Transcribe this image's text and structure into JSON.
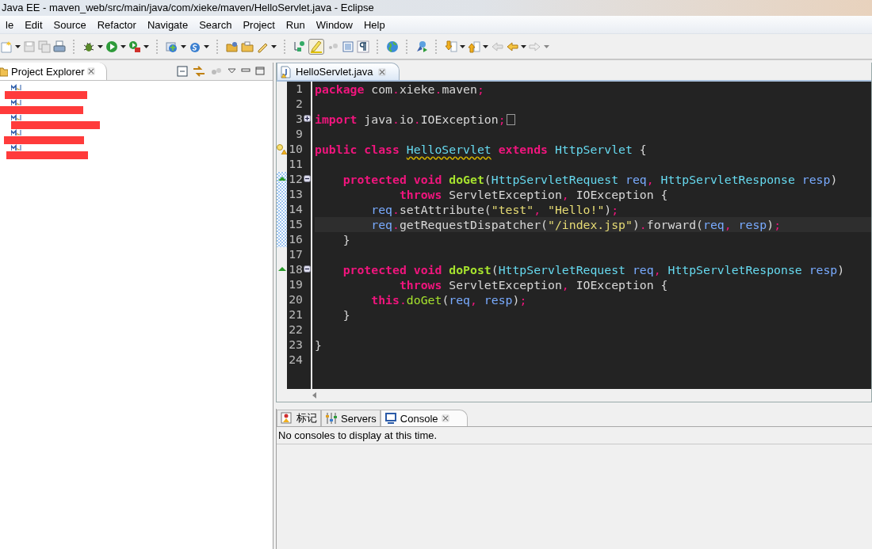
{
  "window": {
    "title": "Java EE - maven_web/src/main/java/com/xieke/maven/HelloServlet.java - Eclipse"
  },
  "menu": [
    "le",
    "Edit",
    "Source",
    "Refactor",
    "Navigate",
    "Search",
    "Project",
    "Run",
    "Window",
    "Help"
  ],
  "toolbar": {
    "highlight_toggle": {
      "pressed": true
    }
  },
  "project_explorer": {
    "title": "Project Explorer",
    "items": [
      {
        "kind": "redacted"
      },
      {
        "kind": "redacted"
      },
      {
        "kind": "redacted"
      },
      {
        "kind": "redacted"
      },
      {
        "kind": "redacted"
      }
    ]
  },
  "editor": {
    "tab": {
      "label": "HelloServlet.java",
      "selected": true
    },
    "lines": [
      {
        "number": "1",
        "current": false,
        "warning": false,
        "override": false,
        "in_range": false,
        "tokens": [
          {
            "text": "package",
            "kind": "kw"
          },
          {
            "text": " com",
            "kind": "pl"
          },
          {
            "text": ".",
            "kind": "op"
          },
          {
            "text": "xieke",
            "kind": "pl"
          },
          {
            "text": ".",
            "kind": "op"
          },
          {
            "text": "maven",
            "kind": "pl"
          },
          {
            "text": ";",
            "kind": "op"
          }
        ]
      },
      {
        "number": "2",
        "current": false,
        "warning": false,
        "override": false,
        "in_range": false
      },
      {
        "number": "3",
        "current": false,
        "warning": false,
        "override": false,
        "in_range": false,
        "fold_expanded": false,
        "tokens": [
          {
            "text": "import",
            "kind": "kw"
          },
          {
            "text": " java",
            "kind": "pl"
          },
          {
            "text": ".",
            "kind": "op"
          },
          {
            "text": "io",
            "kind": "pl"
          },
          {
            "text": ".",
            "kind": "op"
          },
          {
            "text": "IOException",
            "kind": "pl"
          },
          {
            "text": ";",
            "kind": "op"
          }
        ]
      },
      {
        "number": "9",
        "current": false,
        "warning": false,
        "override": false,
        "in_range": false
      },
      {
        "number": "10",
        "current": false,
        "warning": true,
        "override": false,
        "in_range": false,
        "tokens": [
          {
            "text": "public class ",
            "kind": "kw"
          },
          {
            "text": "HelloServlet",
            "kind": "warn"
          },
          {
            "text": " extends",
            "kind": "kw"
          },
          {
            "text": " HttpServlet",
            "kind": "type"
          },
          {
            "text": " {",
            "kind": "pl"
          }
        ]
      },
      {
        "number": "11",
        "current": false,
        "warning": false,
        "override": false,
        "in_range": false
      },
      {
        "number": "12",
        "current": false,
        "warning": false,
        "override": true,
        "in_range": true,
        "fold_expanded": true,
        "tokens": [
          {
            "text": "    protected void ",
            "kind": "kw"
          },
          {
            "text": "doGet",
            "kind": "method"
          },
          {
            "text": "(",
            "kind": "pl"
          },
          {
            "text": "HttpServletRequest",
            "kind": "type"
          },
          {
            "text": " req",
            "kind": "param"
          },
          {
            "text": ",",
            "kind": "op"
          },
          {
            "text": " HttpServletResponse",
            "kind": "type"
          },
          {
            "text": " resp",
            "kind": "param"
          },
          {
            "text": ")",
            "kind": "pl"
          }
        ]
      },
      {
        "number": "13",
        "current": false,
        "warning": false,
        "override": false,
        "in_range": true,
        "tokens": [
          {
            "text": "            throws",
            "kind": "kw"
          },
          {
            "text": " ServletException",
            "kind": "pl"
          },
          {
            "text": ",",
            "kind": "op"
          },
          {
            "text": " IOException {",
            "kind": "pl"
          }
        ]
      },
      {
        "number": "14",
        "current": false,
        "warning": false,
        "override": false,
        "in_range": true,
        "tokens": [
          {
            "text": "        req",
            "kind": "param"
          },
          {
            "text": ".",
            "kind": "op"
          },
          {
            "text": "setAttribute(",
            "kind": "pl"
          },
          {
            "text": "\"test\"",
            "kind": "str"
          },
          {
            "text": ",",
            "kind": "op"
          },
          {
            "text": " \"Hello!\"",
            "kind": "str"
          },
          {
            "text": ")",
            "kind": "pl"
          },
          {
            "text": ";",
            "kind": "op"
          }
        ]
      },
      {
        "number": "15",
        "current": true,
        "warning": false,
        "override": false,
        "in_range": true,
        "tokens": [
          {
            "text": "        req",
            "kind": "param"
          },
          {
            "text": ".",
            "kind": "op"
          },
          {
            "text": "getRequestDispatcher(",
            "kind": "pl"
          },
          {
            "text": "\"/index.jsp\"",
            "kind": "str"
          },
          {
            "text": ")",
            "kind": "pl"
          },
          {
            "text": ".",
            "kind": "op"
          },
          {
            "text": "forward(",
            "kind": "pl"
          },
          {
            "text": "req",
            "kind": "param"
          },
          {
            "text": ",",
            "kind": "op"
          },
          {
            "text": " resp",
            "kind": "param"
          },
          {
            "text": ")",
            "kind": "pl"
          },
          {
            "text": ";",
            "kind": "op"
          }
        ]
      },
      {
        "number": "16",
        "current": false,
        "warning": false,
        "override": false,
        "in_range": true,
        "tokens": [
          {
            "text": "    }",
            "kind": "pl"
          }
        ]
      },
      {
        "number": "17",
        "current": false,
        "warning": false,
        "override": false,
        "in_range": false
      },
      {
        "number": "18",
        "current": false,
        "warning": false,
        "override": true,
        "in_range": false,
        "fold_expanded": true,
        "tokens": [
          {
            "text": "    protected void ",
            "kind": "kw"
          },
          {
            "text": "doPost",
            "kind": "method"
          },
          {
            "text": "(",
            "kind": "pl"
          },
          {
            "text": "HttpServletRequest",
            "kind": "type"
          },
          {
            "text": " req",
            "kind": "param"
          },
          {
            "text": ",",
            "kind": "op"
          },
          {
            "text": " HttpServletResponse",
            "kind": "type"
          },
          {
            "text": " resp",
            "kind": "param"
          },
          {
            "text": ")",
            "kind": "pl"
          }
        ]
      },
      {
        "number": "19",
        "current": false,
        "warning": false,
        "override": false,
        "in_range": false,
        "tokens": [
          {
            "text": "            throws",
            "kind": "kw"
          },
          {
            "text": " ServletException",
            "kind": "pl"
          },
          {
            "text": ",",
            "kind": "op"
          },
          {
            "text": " IOException {",
            "kind": "pl"
          }
        ]
      },
      {
        "number": "20",
        "current": false,
        "warning": false,
        "override": false,
        "in_range": false,
        "tokens": [
          {
            "text": "        this",
            "kind": "kw"
          },
          {
            "text": ".",
            "kind": "op"
          },
          {
            "text": "doGet",
            "kind": "call"
          },
          {
            "text": "(",
            "kind": "pl"
          },
          {
            "text": "req",
            "kind": "param"
          },
          {
            "text": ",",
            "kind": "op"
          },
          {
            "text": " resp",
            "kind": "param"
          },
          {
            "text": ")",
            "kind": "pl"
          },
          {
            "text": ";",
            "kind": "op"
          }
        ]
      },
      {
        "number": "21",
        "current": false,
        "warning": false,
        "override": false,
        "in_range": false,
        "tokens": [
          {
            "text": "    }",
            "kind": "pl"
          }
        ]
      },
      {
        "number": "22",
        "current": false,
        "warning": false,
        "override": false,
        "in_range": false
      },
      {
        "number": "23",
        "current": false,
        "warning": false,
        "override": false,
        "in_range": false,
        "tokens": [
          {
            "text": "}",
            "kind": "pl"
          }
        ]
      },
      {
        "number": "24",
        "current": false,
        "warning": false,
        "override": false,
        "in_range": false
      }
    ]
  },
  "bottom_panel": {
    "tabs": [
      {
        "label": "标记",
        "kind": "markers",
        "selected": false
      },
      {
        "label": "Servers",
        "kind": "servers",
        "selected": false
      },
      {
        "label": "Console",
        "kind": "console",
        "selected": true
      }
    ],
    "message": "No consoles to display at this time."
  }
}
